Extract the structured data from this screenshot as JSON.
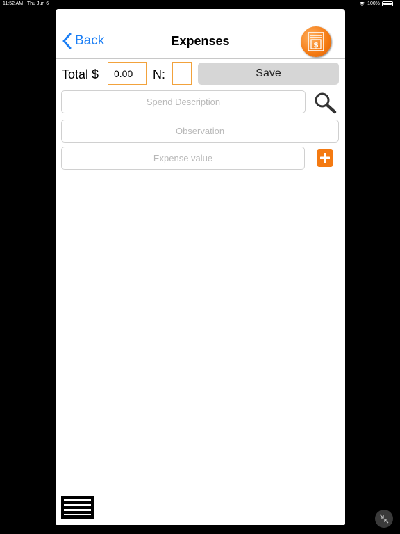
{
  "status_bar": {
    "time": "11:52 AM",
    "date": "Thu Jun 6",
    "battery": "100%"
  },
  "nav": {
    "back_label": "Back",
    "title": "Expenses",
    "receipt_icon": "receipt-dollar-icon"
  },
  "totals": {
    "total_label": "Total $",
    "total_value": "0.00",
    "n_label": "N:",
    "n_value": "",
    "save_label": "Save"
  },
  "form": {
    "spend_placeholder": "Spend Description",
    "observation_placeholder": "Observation",
    "value_placeholder": "Expense value"
  },
  "colors": {
    "accent": "#f47a12",
    "link": "#1a7ef5",
    "input_border": "#f2a23c"
  }
}
